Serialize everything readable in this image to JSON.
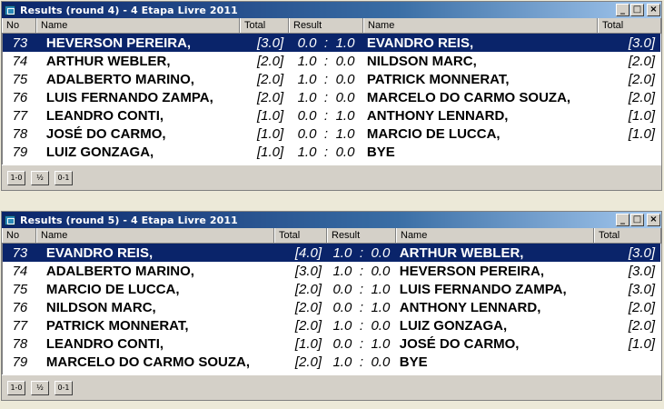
{
  "windows": [
    {
      "title": "Results  (round 4) - 4 Etapa Livre 2011",
      "headers": {
        "no": "No",
        "name": "Name",
        "total": "Total",
        "result": "Result",
        "name2": "Name",
        "total2": "Total"
      },
      "rows": [
        {
          "no": "73",
          "white": "HEVERSON PEREIRA,",
          "wtotal": "[3.0]",
          "wres": "0.0",
          "sep": ":",
          "bres": "1.0",
          "black": "EVANDRO REIS,",
          "btotal": "[3.0]",
          "selected": true
        },
        {
          "no": "74",
          "white": "ARTHUR WEBLER,",
          "wtotal": "[2.0]",
          "wres": "1.0",
          "sep": ":",
          "bres": "0.0",
          "black": "NILDSON MARC,",
          "btotal": "[2.0]"
        },
        {
          "no": "75",
          "white": "ADALBERTO MARINO,",
          "wtotal": "[2.0]",
          "wres": "1.0",
          "sep": ":",
          "bres": "0.0",
          "black": "PATRICK MONNERAT,",
          "btotal": "[2.0]"
        },
        {
          "no": "76",
          "white": "LUIS FERNANDO ZAMPA,",
          "wtotal": "[2.0]",
          "wres": "1.0",
          "sep": ":",
          "bres": "0.0",
          "black": "MARCELO DO CARMO SOUZA,",
          "btotal": "[2.0]"
        },
        {
          "no": "77",
          "white": "LEANDRO CONTI,",
          "wtotal": "[1.0]",
          "wres": "0.0",
          "sep": ":",
          "bres": "1.0",
          "black": "ANTHONY LENNARD,",
          "btotal": "[1.0]"
        },
        {
          "no": "78",
          "white": "JOSÉ DO CARMO,",
          "wtotal": "[1.0]",
          "wres": "0.0",
          "sep": ":",
          "bres": "1.0",
          "black": "MARCIO DE LUCCA,",
          "btotal": "[1.0]"
        },
        {
          "no": "79",
          "white": "LUIZ GONZAGA,",
          "wtotal": "[1.0]",
          "wres": "1.0",
          "sep": ":",
          "bres": "0.0",
          "black": "BYE",
          "btotal": ""
        }
      ],
      "footer_buttons": [
        "1-0",
        "½",
        "0-1"
      ]
    },
    {
      "title": "Results  (round 5) - 4 Etapa Livre 2011",
      "headers": {
        "no": "No",
        "name": "Name",
        "total": "Total",
        "result": "Result",
        "name2": "Name",
        "total2": "Total"
      },
      "rows": [
        {
          "no": "73",
          "white": "EVANDRO REIS,",
          "wtotal": "[4.0]",
          "wres": "1.0",
          "sep": ":",
          "bres": "0.0",
          "black": "ARTHUR WEBLER,",
          "btotal": "[3.0]",
          "selected": true
        },
        {
          "no": "74",
          "white": "ADALBERTO MARINO,",
          "wtotal": "[3.0]",
          "wres": "1.0",
          "sep": ":",
          "bres": "0.0",
          "black": "HEVERSON PEREIRA,",
          "btotal": "[3.0]"
        },
        {
          "no": "75",
          "white": "MARCIO DE LUCCA,",
          "wtotal": "[2.0]",
          "wres": "0.0",
          "sep": ":",
          "bres": "1.0",
          "black": "LUIS FERNANDO ZAMPA,",
          "btotal": "[3.0]"
        },
        {
          "no": "76",
          "white": "NILDSON MARC,",
          "wtotal": "[2.0]",
          "wres": "0.0",
          "sep": ":",
          "bres": "1.0",
          "black": "ANTHONY LENNARD,",
          "btotal": "[2.0]"
        },
        {
          "no": "77",
          "white": "PATRICK MONNERAT,",
          "wtotal": "[2.0]",
          "wres": "1.0",
          "sep": ":",
          "bres": "0.0",
          "black": "LUIZ GONZAGA,",
          "btotal": "[2.0]"
        },
        {
          "no": "78",
          "white": "LEANDRO CONTI,",
          "wtotal": "[1.0]",
          "wres": "0.0",
          "sep": ":",
          "bres": "1.0",
          "black": "JOSÉ DO CARMO,",
          "btotal": "[1.0]"
        },
        {
          "no": "79",
          "white": "MARCELO DO CARMO SOUZA,",
          "wtotal": "[2.0]",
          "wres": "1.0",
          "sep": ":",
          "bres": "0.0",
          "black": "BYE",
          "btotal": ""
        }
      ],
      "footer_buttons": [
        "1-0",
        "½",
        "0-1"
      ]
    }
  ],
  "window_buttons": {
    "minimize": "_",
    "maximize": "□",
    "close": "×"
  },
  "colors": {
    "selected_row": "#0a246a",
    "titlebar": "#0a246a"
  }
}
